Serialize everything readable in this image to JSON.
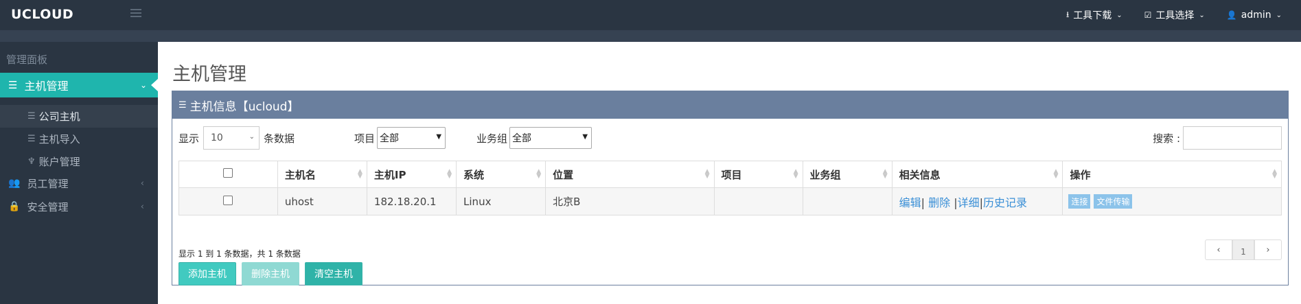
{
  "app": {
    "logo": "UCLOUD"
  },
  "topnav": [
    {
      "icon": "⭳",
      "label": "工具下载",
      "icon_name": "download-icon"
    },
    {
      "icon": "☑",
      "label": "工具选择",
      "icon_name": "checkbox-icon"
    },
    {
      "icon": "👤",
      "label": "admin",
      "icon_name": "user-icon"
    }
  ],
  "sidebar": {
    "heading": "管理面板",
    "active": {
      "label": "主机管理",
      "icon": "☰"
    },
    "sub_items": [
      {
        "label": "公司主机",
        "icon": "☰"
      },
      {
        "label": "主机导入",
        "icon": "☰"
      },
      {
        "label": "账户管理",
        "icon": "♆"
      }
    ],
    "items": [
      {
        "label": "员工管理",
        "icon": "👥"
      },
      {
        "label": "安全管理",
        "icon": "🔒"
      }
    ]
  },
  "page": {
    "title": "主机管理"
  },
  "panel": {
    "title": "主机信息【ucloud】",
    "icon": "☰"
  },
  "controls": {
    "show_label": "显示",
    "length_value": "10",
    "rows_label": "条数据",
    "project_label": "项目",
    "project_value": "全部",
    "group_label": "业务组",
    "group_value": "全部",
    "search_label": "搜索 :"
  },
  "table": {
    "headers": [
      "主机名",
      "主机IP",
      "系统",
      "位置",
      "项目",
      "业务组",
      "相关信息",
      "操作"
    ],
    "rows": [
      {
        "hostname": "uhost",
        "ip": "182.18.20.1",
        "os": "Linux",
        "location": "北京B",
        "project": "",
        "group": "",
        "links": [
          "编辑",
          "删除",
          "详细",
          "历史记录"
        ],
        "actions": [
          "连接",
          "文件传输"
        ]
      }
    ]
  },
  "info": {
    "text": "显示 1 到 1 条数据，共 1 条数据"
  },
  "pager": {
    "prev": "‹",
    "current": "1",
    "next": "›"
  },
  "buttons": {
    "add": "添加主机",
    "delete": "删除主机",
    "clear": "清空主机"
  }
}
